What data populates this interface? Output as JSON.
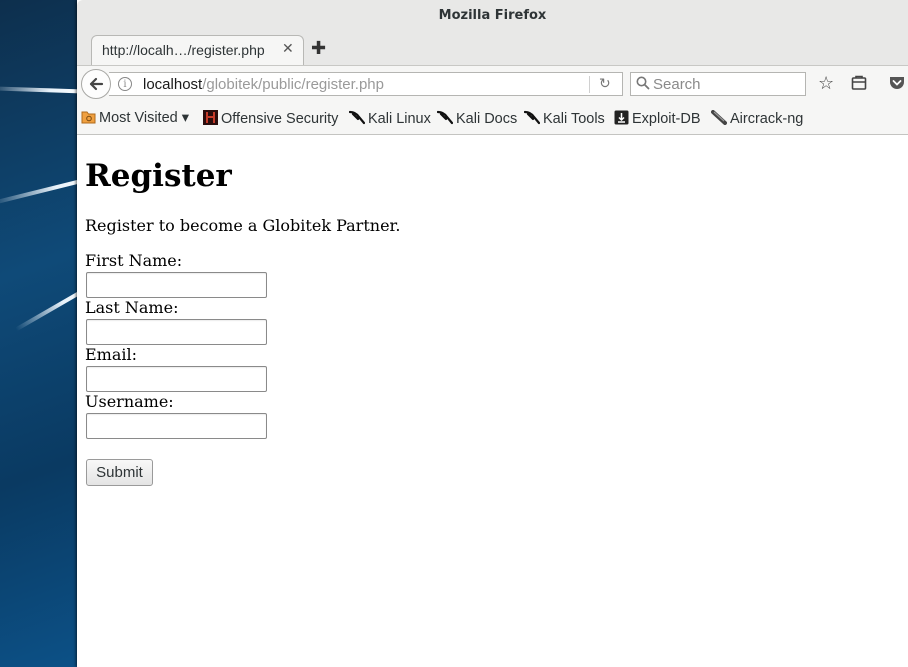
{
  "window": {
    "title": "Mozilla Firefox"
  },
  "tab": {
    "label": "http://localh…/register.php"
  },
  "urlbar": {
    "host": "localhost",
    "path": "/globitek/public/register.php"
  },
  "search": {
    "placeholder": "Search"
  },
  "bookmarks": [
    {
      "label": "Most Visited ▾",
      "icon": "folder-icon"
    },
    {
      "label": "Offensive Security",
      "icon": "offensive-security-icon"
    },
    {
      "label": "Kali Linux",
      "icon": "kali-dragon-icon"
    },
    {
      "label": "Kali Docs",
      "icon": "kali-dragon-icon"
    },
    {
      "label": "Kali Tools",
      "icon": "kali-dragon-icon"
    },
    {
      "label": "Exploit-DB",
      "icon": "exploit-db-icon"
    },
    {
      "label": "Aircrack-ng",
      "icon": "aircrack-icon"
    }
  ],
  "page": {
    "title": "Register",
    "intro": "Register to become a Globitek Partner.",
    "fields": [
      {
        "label": "First Name:",
        "value": ""
      },
      {
        "label": "Last Name:",
        "value": ""
      },
      {
        "label": "Email:",
        "value": ""
      },
      {
        "label": "Username:",
        "value": ""
      }
    ],
    "submit_label": "Submit"
  }
}
